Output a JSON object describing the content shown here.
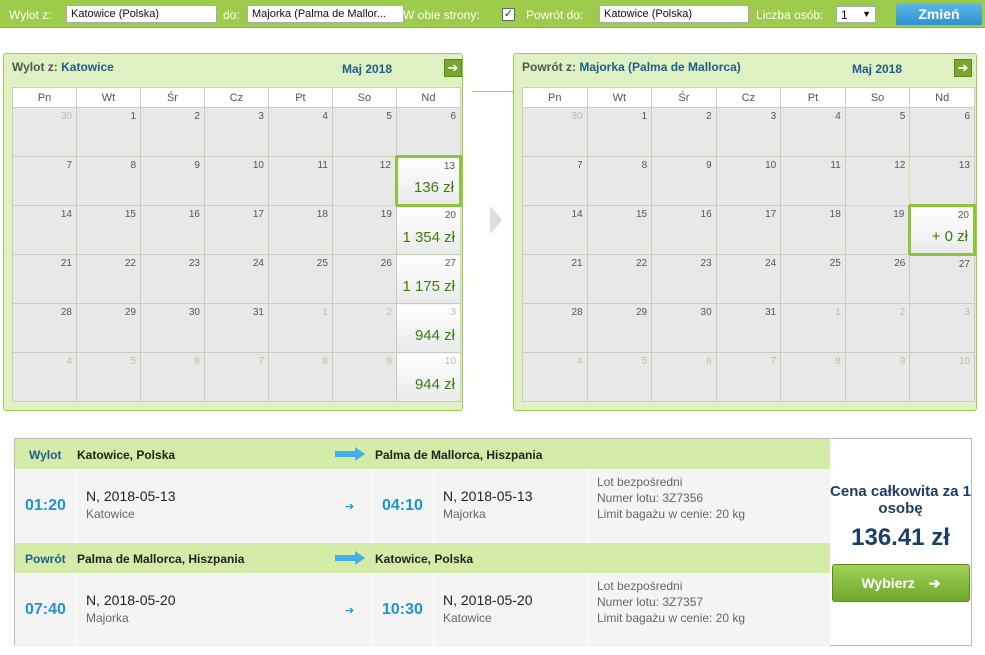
{
  "search": {
    "from_label": "Wylot z:",
    "from_value": "Katowice (Polska)",
    "to_label": "do:",
    "to_value": "Majorka (Palma de Mallor...",
    "both_ways_label": "W obie strony:",
    "both_ways_checked": true,
    "return_label": "Powrót do:",
    "return_value": "Katowice (Polska)",
    "persons_label": "Liczba osób:",
    "persons_value": "1",
    "change_button": "Zmień"
  },
  "calendars": [
    {
      "title_prefix": "Wylot z:",
      "title_city": "Katowice",
      "month": "Maj 2018",
      "weekdays": [
        "Pn",
        "Wt",
        "Śr",
        "Cz",
        "Pt",
        "So",
        "Nd"
      ],
      "weeks": [
        [
          {
            "d": "30",
            "o": true
          },
          {
            "d": "1"
          },
          {
            "d": "2"
          },
          {
            "d": "3"
          },
          {
            "d": "4"
          },
          {
            "d": "5"
          },
          {
            "d": "6"
          }
        ],
        [
          {
            "d": "7"
          },
          {
            "d": "8"
          },
          {
            "d": "9"
          },
          {
            "d": "10"
          },
          {
            "d": "11"
          },
          {
            "d": "12",
            "hl": true
          },
          {
            "d": "13",
            "price": "136 zł",
            "selected": true
          }
        ],
        [
          {
            "d": "14"
          },
          {
            "d": "15"
          },
          {
            "d": "16"
          },
          {
            "d": "17"
          },
          {
            "d": "18"
          },
          {
            "d": "19"
          },
          {
            "d": "20",
            "price": "1 354 zł"
          }
        ],
        [
          {
            "d": "21"
          },
          {
            "d": "22"
          },
          {
            "d": "23"
          },
          {
            "d": "24"
          },
          {
            "d": "25"
          },
          {
            "d": "26"
          },
          {
            "d": "27",
            "price": "1 175 zł"
          }
        ],
        [
          {
            "d": "28"
          },
          {
            "d": "29"
          },
          {
            "d": "30"
          },
          {
            "d": "31"
          },
          {
            "d": "1",
            "o": true
          },
          {
            "d": "2",
            "o": true
          },
          {
            "d": "3",
            "o": true,
            "price": "944 zł"
          }
        ],
        [
          {
            "d": "4",
            "o": true
          },
          {
            "d": "5",
            "o": true
          },
          {
            "d": "6",
            "o": true
          },
          {
            "d": "7",
            "o": true
          },
          {
            "d": "8",
            "o": true
          },
          {
            "d": "9",
            "o": true
          },
          {
            "d": "10",
            "o": true,
            "price": "944 zł"
          }
        ]
      ]
    },
    {
      "title_prefix": "Powrót z:",
      "title_city": "Majorka (Palma de Mallorca)",
      "month": "Maj 2018",
      "weekdays": [
        "Pn",
        "Wt",
        "Śr",
        "Cz",
        "Pt",
        "So",
        "Nd"
      ],
      "weeks": [
        [
          {
            "d": "30",
            "o": true
          },
          {
            "d": "1"
          },
          {
            "d": "2"
          },
          {
            "d": "3"
          },
          {
            "d": "4"
          },
          {
            "d": "5"
          },
          {
            "d": "6"
          }
        ],
        [
          {
            "d": "7"
          },
          {
            "d": "8"
          },
          {
            "d": "9"
          },
          {
            "d": "10"
          },
          {
            "d": "11"
          },
          {
            "d": "12",
            "hl": true
          },
          {
            "d": "13"
          }
        ],
        [
          {
            "d": "14"
          },
          {
            "d": "15"
          },
          {
            "d": "16"
          },
          {
            "d": "17"
          },
          {
            "d": "18"
          },
          {
            "d": "19"
          },
          {
            "d": "20",
            "price": "+ 0 zł",
            "selected": true
          }
        ],
        [
          {
            "d": "21"
          },
          {
            "d": "22"
          },
          {
            "d": "23"
          },
          {
            "d": "24"
          },
          {
            "d": "25"
          },
          {
            "d": "26"
          },
          {
            "d": "27"
          }
        ],
        [
          {
            "d": "28"
          },
          {
            "d": "29"
          },
          {
            "d": "30"
          },
          {
            "d": "31"
          },
          {
            "d": "1",
            "o": true
          },
          {
            "d": "2",
            "o": true
          },
          {
            "d": "3",
            "o": true
          }
        ],
        [
          {
            "d": "4",
            "o": true
          },
          {
            "d": "5",
            "o": true
          },
          {
            "d": "6",
            "o": true
          },
          {
            "d": "7",
            "o": true
          },
          {
            "d": "8",
            "o": true
          },
          {
            "d": "9",
            "o": true
          },
          {
            "d": "10",
            "o": true
          }
        ]
      ]
    }
  ],
  "outbound": {
    "label": "Wylot",
    "from": "Katowice, Polska",
    "to": "Palma de Mallorca, Hiszpania",
    "dep_time": "01:20",
    "dep_date": "N, 2018-05-13",
    "dep_city": "Katowice",
    "arr_time": "04:10",
    "arr_date": "N, 2018-05-13",
    "arr_city": "Majorka",
    "info1": "Lot bezpośredni",
    "info2": "Numer lotu: 3Z7356",
    "info3": "Limit bagażu w cenie: 20 kg"
  },
  "inbound": {
    "label": "Powrót",
    "from": "Palma de Mallorca, Hiszpania",
    "to": "Katowice, Polska",
    "dep_time": "07:40",
    "dep_date": "N, 2018-05-20",
    "dep_city": "Majorka",
    "arr_time": "10:30",
    "arr_date": "N, 2018-05-20",
    "arr_city": "Katowice",
    "info1": "Lot bezpośredni",
    "info2": "Numer lotu: 3Z7357",
    "info3": "Limit bagażu w cenie: 20 kg"
  },
  "price": {
    "label": "Cena całkowita za 1 osobę",
    "value": "136.41 zł",
    "button": "Wybierz"
  },
  "colors": {
    "accent_green": "#9ccc4a",
    "price_green": "#3b7d0e",
    "time_blue": "#1f94d2",
    "button_blue": "#2c8fce"
  }
}
